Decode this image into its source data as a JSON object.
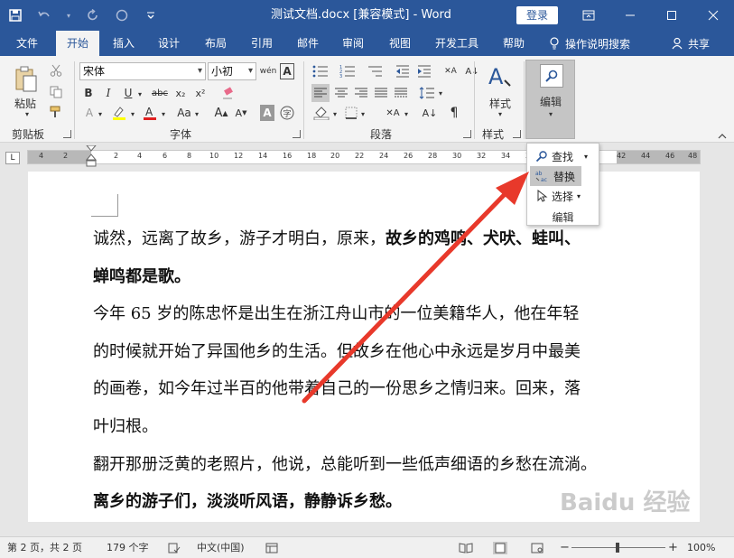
{
  "titlebar": {
    "doc_title": "测试文档.docx [兼容模式]  -  Word",
    "login_label": "登录"
  },
  "tabs": [
    {
      "label": "文件"
    },
    {
      "label": "开始"
    },
    {
      "label": "插入"
    },
    {
      "label": "设计"
    },
    {
      "label": "布局"
    },
    {
      "label": "引用"
    },
    {
      "label": "邮件"
    },
    {
      "label": "审阅"
    },
    {
      "label": "视图"
    },
    {
      "label": "开发工具"
    },
    {
      "label": "帮助"
    }
  ],
  "tell_me": "操作说明搜索",
  "share": "共享",
  "ribbon": {
    "paste_label": "粘贴",
    "font_name": "宋体",
    "font_size": "小初",
    "style_label": "样式",
    "edit_label": "编辑",
    "groups": {
      "clipboard": "剪贴板",
      "font": "字体",
      "paragraph": "段落",
      "styles": "样式"
    }
  },
  "ruler_numbers": [
    "4",
    "2",
    "2",
    "4",
    "6",
    "8",
    "10",
    "12",
    "14",
    "16",
    "18",
    "20",
    "22",
    "24",
    "26",
    "28",
    "30",
    "32",
    "34",
    "36",
    "38",
    "40",
    "42",
    "44",
    "46",
    "48"
  ],
  "edit_menu": {
    "find": "查找",
    "replace": "替换",
    "select": "选择",
    "label": "编辑"
  },
  "document": {
    "lines": [
      {
        "normal": "诚然，远离了故乡，游子才明白，原来，",
        "bold": "故乡的鸡鸣、犬吠、蛙叫、"
      },
      {
        "normal": "",
        "bold": "蝉鸣都是歌。"
      },
      {
        "normal": "今年 65 岁的陈忠怀是出生在浙江舟山市的一位美籍华人，他在年轻",
        "bold": ""
      },
      {
        "normal": "的时候就开始了异国他乡的生活。但故乡在他心中永远是岁月中最美",
        "bold": ""
      },
      {
        "normal": "的画卷，如今年过半百的他带着自己的一份思乡之情归来。回来，落",
        "bold": ""
      },
      {
        "normal": "叶归根。",
        "bold": ""
      },
      {
        "normal": "翻开那册泛黄的老照片，他说，总能听到一些低声细语的乡愁在流淌。",
        "bold": ""
      },
      {
        "normal": "",
        "bold": "离乡的游子们，淡淡听风语，静静诉乡愁。"
      }
    ]
  },
  "status": {
    "page": "第 2 页，共 2 页",
    "words": "179 个字",
    "lang": "中文(中国)",
    "zoom": "100%"
  },
  "watermark": "Baidu 经验",
  "colors": {
    "brand": "#2b579a",
    "arrow": "#e8392b"
  }
}
